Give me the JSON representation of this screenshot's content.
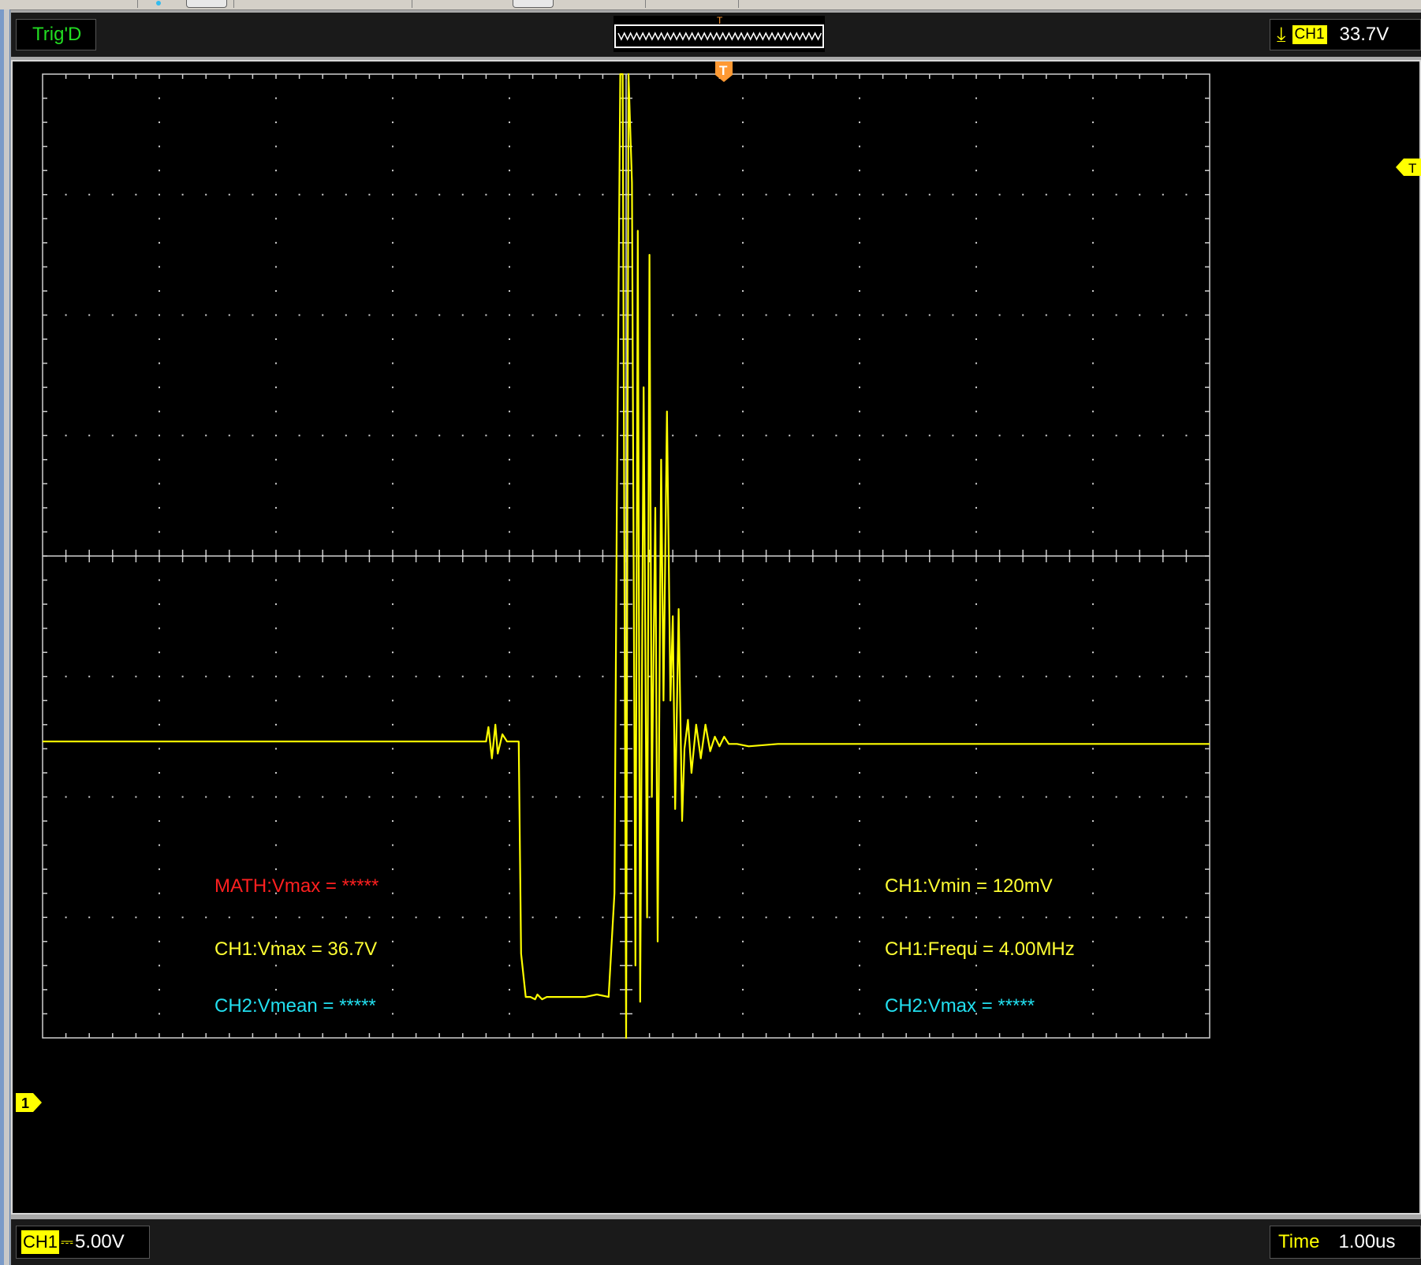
{
  "status_top": {
    "trigger_state": "Trig'D",
    "trigger_position_marker": "T",
    "trigger_source": "CH1",
    "trigger_level": "33.7V",
    "trigger_edge_icon": "falling-edge-icon"
  },
  "status_bottom": {
    "channel": "CH1",
    "coupling_symbol": "⎓",
    "volts_per_div": "5.00V",
    "time_label": "Time",
    "time_per_div": "1.00us"
  },
  "markers": {
    "trigger_position": "T",
    "trigger_level": "T",
    "ch1_reference": "1"
  },
  "measurements": {
    "math_vmax": "MATH:Vmax = *****",
    "ch1_vmax": "CH1:Vmax = 36.7V",
    "ch2_vmean": "CH2:Vmean = *****",
    "ch1_vmin": "CH1:Vmin = 120mV",
    "ch1_frequ": "CH1:Frequ = 4.00MHz",
    "ch2_vmax": "CH2:Vmax = *****"
  },
  "colors": {
    "trace": "#ffff00",
    "grid": "#d0d0d0",
    "math": "#ff2020",
    "ch1": "#ffff33",
    "ch2": "#22e0f0",
    "trigd": "#22dd22",
    "marker": "#ff9933"
  },
  "chart_data": {
    "type": "line",
    "title": "",
    "xlabel": "",
    "ylabel": "",
    "x_unit": "us",
    "y_unit": "V",
    "xlim": [
      -5,
      5
    ],
    "ylim": [
      -8,
      32
    ],
    "grid": true,
    "series": [
      {
        "x": [
          -5.0,
          -1.2,
          -1.18,
          -1.15,
          -1.12,
          -1.1,
          -1.06,
          -1.02,
          -1.0,
          -0.92,
          -0.9,
          -0.86,
          -0.82,
          -0.78,
          -0.76,
          -0.72,
          -0.68,
          -0.65,
          -0.55,
          -0.45,
          -0.35,
          -0.25,
          -0.15,
          -0.1,
          -0.08,
          -0.05,
          -0.03,
          0.0,
          0.02,
          0.05,
          0.08,
          0.1,
          0.12,
          0.15,
          0.18,
          0.2,
          0.22,
          0.25,
          0.27,
          0.3,
          0.32,
          0.35,
          0.38,
          0.4,
          0.42,
          0.45,
          0.48,
          0.5,
          0.53,
          0.56,
          0.6,
          0.64,
          0.68,
          0.72,
          0.76,
          0.8,
          0.84,
          0.88,
          0.95,
          1.05,
          1.3,
          5.0
        ],
        "y": [
          4.3,
          4.3,
          4.9,
          3.6,
          5.0,
          3.8,
          4.6,
          4.3,
          4.3,
          4.3,
          -4.5,
          -6.3,
          -6.3,
          -6.4,
          -6.2,
          -6.4,
          -6.3,
          -6.3,
          -6.3,
          -6.3,
          -6.3,
          -6.2,
          -6.3,
          -2.0,
          14.0,
          32.0,
          32.0,
          -8.0,
          32.0,
          27.5,
          -5.0,
          25.5,
          -6.5,
          19.0,
          -3.0,
          24.5,
          2.0,
          14.0,
          -4.0,
          16.0,
          6.0,
          18.0,
          6.0,
          9.5,
          1.5,
          9.8,
          1.0,
          4.0,
          5.2,
          3.0,
          5.0,
          3.6,
          5.0,
          3.9,
          4.5,
          4.1,
          4.5,
          4.2,
          4.2,
          4.1,
          4.2,
          4.2
        ]
      }
    ]
  }
}
